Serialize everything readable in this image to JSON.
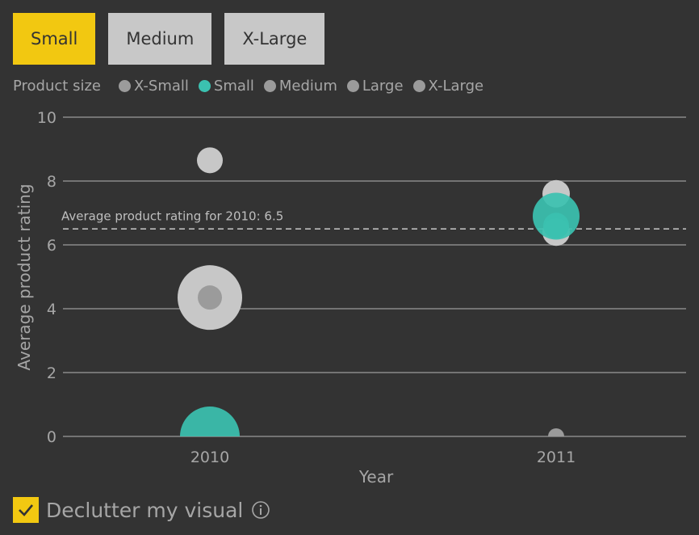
{
  "slicer": {
    "buttons": [
      {
        "label": "Small",
        "selected": true
      },
      {
        "label": "Medium",
        "selected": false
      },
      {
        "label": "X-Large",
        "selected": false
      }
    ]
  },
  "legend": {
    "title": "Product size",
    "items": [
      {
        "label": "X-Small",
        "color": "#9b9b9b"
      },
      {
        "label": "Small",
        "color": "#3bc1b0"
      },
      {
        "label": "Medium",
        "color": "#9b9b9b"
      },
      {
        "label": "Large",
        "color": "#9b9b9b"
      },
      {
        "label": "X-Large",
        "color": "#9b9b9b"
      }
    ]
  },
  "chart_data": {
    "type": "scatter",
    "xlabel": "Year",
    "ylabel": "Average product rating",
    "categories": [
      "2010",
      "2011"
    ],
    "ylim": [
      0,
      10
    ],
    "yticks": [
      0,
      2,
      4,
      6,
      8,
      10
    ],
    "grid": true,
    "legend_placement": "top-left",
    "reference_line": {
      "value": 6.5,
      "label": "Average product rating for 2010: 6.5"
    },
    "series": [
      {
        "name": "X-Small",
        "color": "#9b9b9b",
        "highlighted": false,
        "points": [
          {
            "x": "2010",
            "y": 4.35,
            "size": 15
          },
          {
            "x": "2011",
            "y": 0.0,
            "size": 10
          }
        ]
      },
      {
        "name": "Medium",
        "color": "#c7c7c7",
        "highlighted": false,
        "points": [
          {
            "x": "2010",
            "y": 4.35,
            "size": 40
          },
          {
            "x": "2011",
            "y": 6.4,
            "size": 17
          }
        ]
      },
      {
        "name": "Large",
        "color": "#c7c7c7",
        "highlighted": false,
        "points": [
          {
            "x": "2010",
            "y": 8.65,
            "size": 16
          },
          {
            "x": "2011",
            "y": 7.6,
            "size": 17
          }
        ]
      },
      {
        "name": "Small",
        "color": "#3bc1b0",
        "highlighted": true,
        "points": [
          {
            "x": "2010",
            "y": 0.0,
            "size": 37
          },
          {
            "x": "2011",
            "y": 6.9,
            "size": 29
          },
          {
            "x": "2011",
            "y": 6.6,
            "size": 16
          }
        ]
      }
    ]
  },
  "colors": {
    "background": "#333333",
    "accent": "#f2c811",
    "highlight": "#3bc1b0",
    "muted": "#c7c7c7",
    "gridline": "#8a8a8a"
  },
  "declutter": {
    "label": "Declutter my visual",
    "checked": true,
    "icon": "info-icon"
  }
}
